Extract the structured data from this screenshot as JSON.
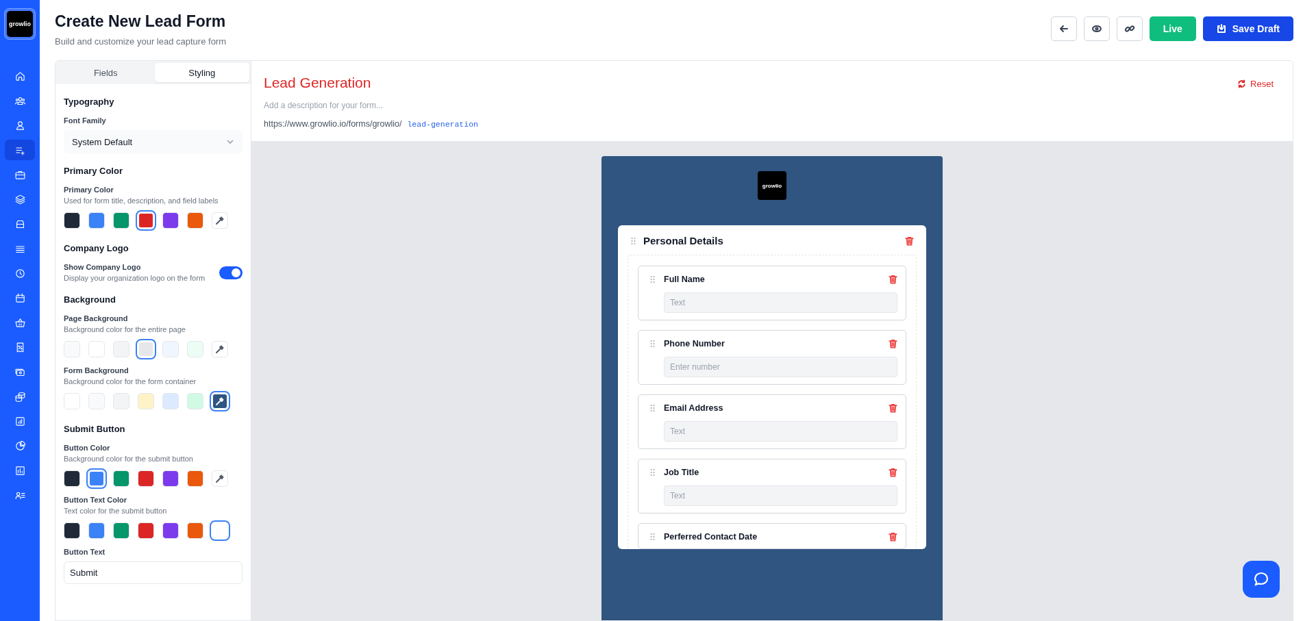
{
  "sidebar": {
    "logo": "growlio",
    "items": [
      {
        "selected": false
      },
      {
        "selected": false
      },
      {
        "selected": false
      },
      {
        "selected": true
      },
      {
        "selected": false
      },
      {
        "selected": false
      },
      {
        "selected": false
      },
      {
        "selected": false
      },
      {
        "selected": false
      },
      {
        "selected": false
      },
      {
        "selected": false
      },
      {
        "selected": false
      },
      {
        "selected": false
      },
      {
        "selected": false
      },
      {
        "selected": false
      },
      {
        "selected": false
      },
      {
        "selected": false
      },
      {
        "selected": false
      }
    ]
  },
  "header": {
    "title": "Create New Lead Form",
    "subtitle": "Build and customize your lead capture form",
    "actions": [
      {
        "kind": "back"
      },
      {
        "kind": "preview"
      },
      {
        "kind": "link"
      },
      {
        "kind": "live",
        "label": "Live"
      },
      {
        "kind": "save",
        "label": "Save Draft"
      }
    ]
  },
  "panel": {
    "tabs": [
      {
        "label": "Fields",
        "selected": false
      },
      {
        "label": "Styling",
        "selected": true
      }
    ],
    "sections": [
      {
        "title": "Typography",
        "items": [
          {
            "kind": "select",
            "label": "Font Family",
            "value": "System Default"
          }
        ]
      },
      {
        "title": "Primary Color",
        "items": [
          {
            "kind": "swatches",
            "label": "Primary Color",
            "description": "Used for form title, description, and field labels",
            "swatches": [
              {
                "kind": "color",
                "color": "#1f2937",
                "selected": false
              },
              {
                "kind": "color",
                "color": "#3b82f6",
                "selected": false
              },
              {
                "kind": "color",
                "color": "#059669",
                "selected": false
              },
              {
                "kind": "color",
                "color": "#dc2626",
                "selected": true
              },
              {
                "kind": "color",
                "color": "#7c3aed",
                "selected": false
              },
              {
                "kind": "color",
                "color": "#ea580c",
                "selected": false
              },
              {
                "kind": "picker",
                "selected": false
              }
            ]
          }
        ]
      },
      {
        "title": "Company Logo",
        "items": [
          {
            "kind": "toggle",
            "label": "Show Company Logo",
            "description": "Display your organization logo on the form",
            "on": true
          }
        ]
      },
      {
        "title": "Background",
        "items": [
          {
            "kind": "swatches",
            "label": "Page Background",
            "description": "Background color for the entire page",
            "swatches": [
              {
                "kind": "color",
                "color": "#f9fafb",
                "selected": false
              },
              {
                "kind": "color",
                "color": "#ffffff",
                "selected": false
              },
              {
                "kind": "color",
                "color": "#f3f4f6",
                "selected": false
              },
              {
                "kind": "color",
                "color": "#e5e7eb",
                "selected": true
              },
              {
                "kind": "color",
                "color": "#eff6ff",
                "selected": false
              },
              {
                "kind": "color",
                "color": "#ecfdf5",
                "selected": false
              },
              {
                "kind": "picker",
                "selected": false
              }
            ]
          },
          {
            "kind": "swatches",
            "label": "Form Background",
            "description": "Background color for the form container",
            "swatches": [
              {
                "kind": "color",
                "color": "#ffffff",
                "selected": false
              },
              {
                "kind": "color",
                "color": "#f9fafb",
                "selected": false
              },
              {
                "kind": "color",
                "color": "#f3f4f6",
                "selected": false
              },
              {
                "kind": "color",
                "color": "#fef3c7",
                "selected": false
              },
              {
                "kind": "color",
                "color": "#dbeafe",
                "selected": false
              },
              {
                "kind": "color",
                "color": "#d1fae5",
                "selected": false
              },
              {
                "kind": "picker",
                "selected": true,
                "color": "#2f5580"
              }
            ]
          }
        ]
      },
      {
        "title": "Submit Button",
        "items": [
          {
            "kind": "swatches",
            "label": "Button Color",
            "description": "Background color for the submit button",
            "swatches": [
              {
                "kind": "color",
                "color": "#1f2937",
                "selected": false
              },
              {
                "kind": "color",
                "color": "#3b82f6",
                "selected": true
              },
              {
                "kind": "color",
                "color": "#059669",
                "selected": false
              },
              {
                "kind": "color",
                "color": "#dc2626",
                "selected": false
              },
              {
                "kind": "color",
                "color": "#7c3aed",
                "selected": false
              },
              {
                "kind": "color",
                "color": "#ea580c",
                "selected": false
              },
              {
                "kind": "picker",
                "selected": false
              }
            ]
          },
          {
            "kind": "swatches",
            "label": "Button Text Color",
            "description": "Text color for the submit button",
            "swatches": [
              {
                "kind": "color",
                "color": "#1f2937",
                "selected": false
              },
              {
                "kind": "color",
                "color": "#3b82f6",
                "selected": false
              },
              {
                "kind": "color",
                "color": "#059669",
                "selected": false
              },
              {
                "kind": "color",
                "color": "#dc2626",
                "selected": false
              },
              {
                "kind": "color",
                "color": "#7c3aed",
                "selected": false
              },
              {
                "kind": "color",
                "color": "#ea580c",
                "selected": false
              },
              {
                "kind": "color",
                "color": "#ffffff",
                "selected": true
              }
            ]
          },
          {
            "kind": "input",
            "label": "Button Text",
            "value": "Submit"
          }
        ]
      }
    ]
  },
  "form": {
    "title": "Lead Generation",
    "description": {
      "placeholder": "Add a description for your form..."
    },
    "url_base": "https://www.growlio.io/forms/growlio/",
    "slug": "lead-generation",
    "reset": "Reset",
    "logo": "growlio",
    "section": {
      "title": "Personal Details",
      "fields": [
        {
          "label": "Full Name",
          "placeholder": "Text"
        },
        {
          "label": "Phone Number",
          "placeholder": "Enter number"
        },
        {
          "label": "Email Address",
          "placeholder": "Text"
        },
        {
          "label": "Job Title",
          "placeholder": "Text"
        },
        {
          "label": "Perferred Contact Date"
        }
      ]
    }
  }
}
